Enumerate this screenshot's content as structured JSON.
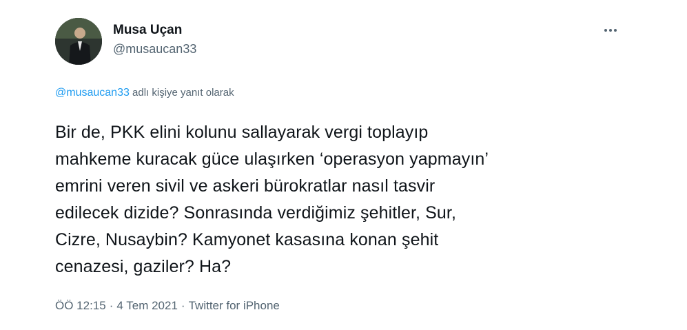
{
  "user": {
    "display_name": "Musa Uçan",
    "handle": "@musaucan33"
  },
  "reply": {
    "mention": "@musaucan33",
    "suffix": " adlı kişiye yanıt olarak"
  },
  "tweet": {
    "lines": [
      "Bir de, PKK elini kolunu sallayarak vergi toplayıp",
      "mahkeme kuracak güce ulaşırken ‘operasyon yapmayın’",
      "emrini veren sivil ve askeri bürokratlar nasıl tasvir",
      "edilecek dizide? Sonrasında verdiğimiz şehitler, Sur,",
      "Cizre, Nusaybin? Kamyonet kasasına konan şehit",
      "cenazesi, gaziler? Ha?"
    ]
  },
  "meta": {
    "time": "ÖÖ 12:15",
    "separator": "·",
    "date": "4 Tem 2021",
    "source": "Twitter for iPhone"
  },
  "icons": {
    "more": "more-horizontal-icon"
  },
  "colors": {
    "text": "#0f1419",
    "secondary": "#536471",
    "link": "#1d9bf0"
  }
}
